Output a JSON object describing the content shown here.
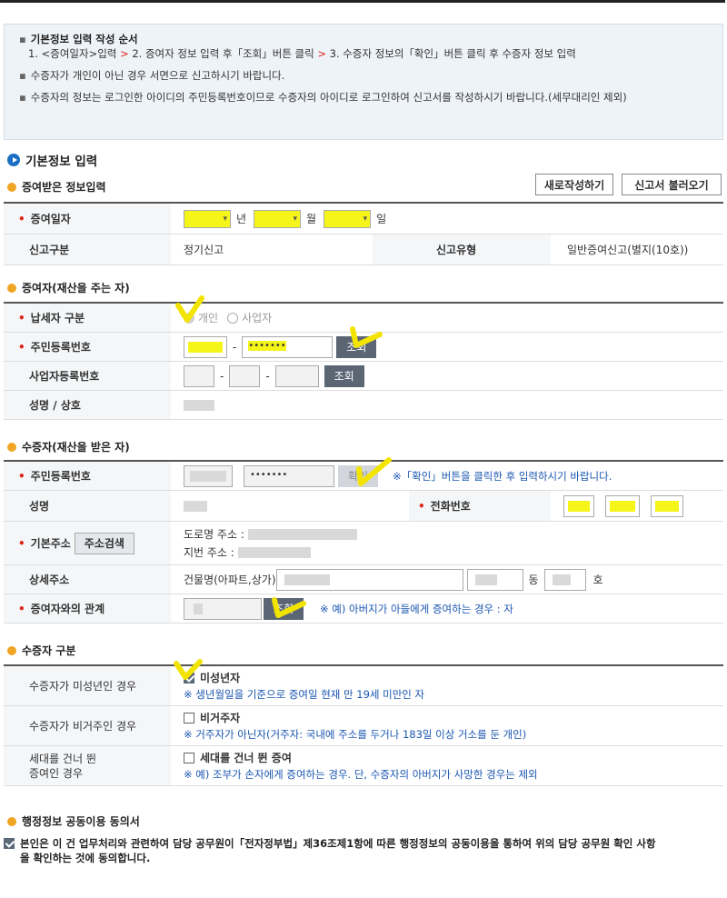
{
  "notice": {
    "title": "기본정보 입력 작성 순서",
    "step1": "1. <증여일자>입력",
    "step2": "2. 증여자 정보 입력 후「조회」버튼 클릭",
    "step3": "3. 수증자 정보의「확인」버튼 클릭 후 수증자 정보 입력",
    "sep": ">",
    "line2": "수증자가 개인이 아닌 경우 서면으로 신고하시기 바랍니다.",
    "line3": "수증자의 정보는 로그인한 아이디의 주민등록번호이므로 수증자의 아이디로 로그인하여 신고서를 작성하시기 바랍니다.(세무대리인 제외)"
  },
  "section_title": "기본정보 입력",
  "gift_info": {
    "heading": "증여받은 정보입력",
    "new_button": "새로작성하기",
    "load_button": "신고서 불러오기",
    "date_label": "증여일자",
    "year_unit": "년",
    "month_unit": "월",
    "day_unit": "일",
    "report_kind_label": "신고구분",
    "report_kind_value": "정기신고",
    "report_type_label": "신고유형",
    "report_type_value": "일반증여신고(별지(10호))"
  },
  "donor": {
    "heading": "증여자(재산을 주는 자)",
    "taxpayer_type_label": "납세자 구분",
    "type_individual": "개인",
    "type_business": "사업자",
    "rrn_label": "주민등록번호",
    "rrn_masked": "•••••••",
    "dash": "-",
    "search_button": "조회",
    "biz_no_label": "사업자등록번호",
    "biz_search_button": "조회",
    "name_label": "성명 / 상호"
  },
  "donee": {
    "heading": "수증자(재산을 받은 자)",
    "rrn_label": "주민등록번호",
    "rrn_masked": "•••••••",
    "confirm_button": "확인",
    "confirm_note": "※「확인」버튼을 클릭한 후 입력하시기 바랍니다.",
    "name_label": "성명",
    "phone_label": "전화번호",
    "address_label": "기본주소",
    "address_search_button": "주소검색",
    "road_address_label": "도로명 주소 :",
    "lot_address_label": "지번 주소 :",
    "detail_address_label": "상세주소",
    "building_label": "건물명(아파트,상가)",
    "dong_unit": "동",
    "ho_unit": "호",
    "relation_label": "증여자와의 관계",
    "relation_search_button": "조회",
    "relation_note": "※ 예) 아버지가 아들에게 증여하는 경우 : 자"
  },
  "donee_type": {
    "heading": "수증자 구분",
    "minor_label": "수증자가 미성년인 경우",
    "minor_option": "미성년자",
    "minor_note": "※ 생년월일을 기준으로 증여일 현재 만 19세 미만인 자",
    "minor_checked": true,
    "nonres_label": "수증자가 비거주인 경우",
    "nonres_option": "비거주자",
    "nonres_note": "※ 거주자가 아닌자(거주자: 국내에 주소를 두거나 183일 이상 거소를 둔 개인)",
    "nonres_checked": false,
    "skip_label_1": "세대를 건너 뛴",
    "skip_label_2": "증여인 경우",
    "skip_option": "세대를 건너 뛴 증여",
    "skip_note": "※ 예) 조부가 손자에게 증여하는 경우. 단, 수증자의 아버지가 사망한 경우는 제외",
    "skip_checked": false
  },
  "consent": {
    "heading": "행정정보 공동이용 동의서",
    "text": "본인은 이 건 업무처리와 관련하여 담당 공무원이「전자정부법」제36조제1항에 따른 행정정보의 공동이용을 통하여 위의 담당 공무원 확인 사항을 확인하는 것에 동의합니다.",
    "checked": true
  },
  "colors": {
    "accent_blue": "#1a6fc4",
    "required_red": "#e2231a",
    "note_blue": "#1a56b0",
    "highlight_yellow": "#f5f51a"
  }
}
